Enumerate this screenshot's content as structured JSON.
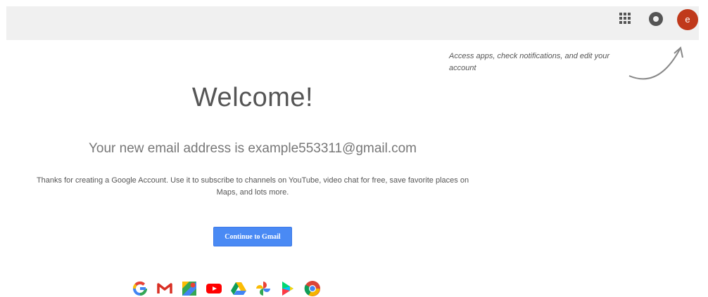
{
  "header": {
    "apps_icon": "apps-grid-icon",
    "notifications_icon": "notifications-icon",
    "avatar_letter": "e",
    "avatar_color": "#c0391b"
  },
  "hint": {
    "text": "Access apps, check notifications, and edit your account"
  },
  "main": {
    "title": "Welcome!",
    "email_line": "Your new email address is example553311@gmail.com",
    "description": "Thanks for creating a Google Account. Use it to subscribe to channels on YouTube, video chat for free, save favorite places on Maps, and lots more.",
    "continue_label": "Continue to Gmail",
    "accent_color": "#4a8af4"
  },
  "products": [
    {
      "name": "google-search-icon"
    },
    {
      "name": "gmail-icon"
    },
    {
      "name": "maps-icon"
    },
    {
      "name": "youtube-icon"
    },
    {
      "name": "drive-icon"
    },
    {
      "name": "photos-icon"
    },
    {
      "name": "play-store-icon"
    },
    {
      "name": "chrome-icon"
    }
  ]
}
